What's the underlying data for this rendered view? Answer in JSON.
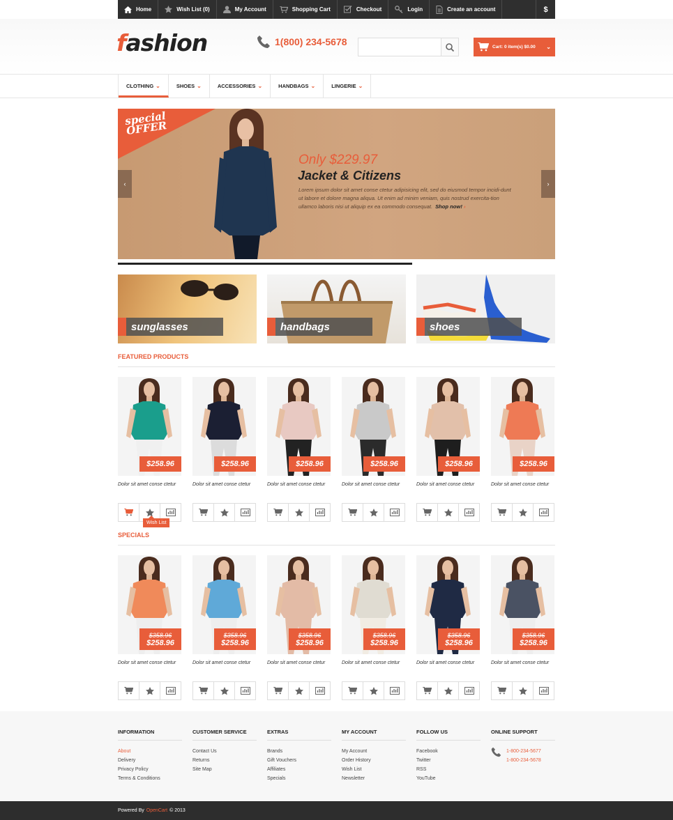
{
  "topbar": {
    "items": [
      {
        "label": "Home",
        "icon": "home-icon"
      },
      {
        "label": "Wish List (0)",
        "icon": "star-icon"
      },
      {
        "label": "My Account",
        "icon": "user-icon"
      },
      {
        "label": "Shopping Cart",
        "icon": "cart-icon"
      },
      {
        "label": "Checkout",
        "icon": "checkout-icon"
      },
      {
        "label": "Login",
        "icon": "key-icon"
      },
      {
        "label": "Create an account",
        "icon": "document-icon"
      }
    ],
    "currency": "$"
  },
  "header": {
    "logo_first": "f",
    "logo_rest": "ashion",
    "phone": "1(800) 234-5678",
    "search_placeholder": "",
    "cart_label": "Cart: 0 item(s) $0.00"
  },
  "nav": [
    {
      "label": "CLOTHING"
    },
    {
      "label": "SHOES"
    },
    {
      "label": "ACCESSORIES"
    },
    {
      "label": "HANDBAGS"
    },
    {
      "label": "LINGERIE"
    }
  ],
  "slider": {
    "badge_line1": "special",
    "badge_line2": "OFFER",
    "price": "Only $229.97",
    "title": "Jacket & Citizens",
    "text": "Lorem ipsum dolor sit amet conse ctetur adipisicing elit, sed do eiusmod tempor incidi-dunt ut labore et dolore magna aliqua. Ut enim ad minim veniam, quis nostrud exercita-tion ullamco laboris nisi ut aliquip ex ea commodo consequat.",
    "shop_now": "Shop now!"
  },
  "banners": [
    {
      "label": "sunglasses"
    },
    {
      "label": "handbags"
    },
    {
      "label": "shoes"
    }
  ],
  "featured": {
    "title": "FEATURED PRODUCTS",
    "products": [
      {
        "price": "$258.96",
        "name": "Dolor sit amet conse ctetur",
        "top": "#1a9e8c",
        "bottom": "#f0f0f0"
      },
      {
        "price": "$258.96",
        "name": "Dolor sit amet conse ctetur",
        "top": "#1b1f33",
        "bottom": "#dcdcdc"
      },
      {
        "price": "$258.96",
        "name": "Dolor sit amet conse ctetur",
        "top": "#e8c9c2",
        "bottom": "#222222"
      },
      {
        "price": "$258.96",
        "name": "Dolor sit amet conse ctetur",
        "top": "#c9c9c9",
        "bottom": "#2b2b2b"
      },
      {
        "price": "$258.96",
        "name": "Dolor sit amet conse ctetur",
        "top": "#e2c0aa",
        "bottom": "#1e1e1e"
      },
      {
        "price": "$258.96",
        "name": "Dolor sit amet conse ctetur",
        "top": "#ee7a55",
        "bottom": "#e9d3c7"
      }
    ]
  },
  "wishlist_tooltip": "Wish List",
  "specials": {
    "title": "SPECIALS",
    "products": [
      {
        "old": "$358.96",
        "price": "$258.96",
        "name": "Dolor sit amet conse ctetur",
        "top": "#f08a5a",
        "bottom": "#eeeeee"
      },
      {
        "old": "$358.96",
        "price": "$258.96",
        "name": "Dolor sit amet conse ctetur",
        "top": "#5fa9d8",
        "bottom": "#eeeeee"
      },
      {
        "old": "$358.96",
        "price": "$258.96",
        "name": "Dolor sit amet conse ctetur",
        "top": "#e3bba6",
        "bottom": "#e3bba6"
      },
      {
        "old": "$358.96",
        "price": "$258.96",
        "name": "Dolor sit amet conse ctetur",
        "top": "#e0dcd2",
        "bottom": "#f1ece3"
      },
      {
        "old": "$358.96",
        "price": "$258.96",
        "name": "Dolor sit amet conse ctetur",
        "top": "#1f2a44",
        "bottom": "#1f2a44"
      },
      {
        "old": "$358.96",
        "price": "$258.96",
        "name": "Dolor sit amet conse ctetur",
        "top": "#4a5263",
        "bottom": "#eeeeee"
      }
    ]
  },
  "footer": {
    "columns": [
      {
        "title": "INFORMATION",
        "links": [
          "About",
          "Delivery",
          "Privacy Policy",
          "Terms & Conditions"
        ]
      },
      {
        "title": "CUSTOMER SERVICE",
        "links": [
          "Contact Us",
          "Returns",
          "Site Map"
        ]
      },
      {
        "title": "EXTRAS",
        "links": [
          "Brands",
          "Gift Vouchers",
          "Affiliates",
          "Specials"
        ]
      },
      {
        "title": "MY ACCOUNT",
        "links": [
          "My Account",
          "Order History",
          "Wish List",
          "Newsletter"
        ]
      },
      {
        "title": "FOLLOW US",
        "links": [
          "Facebook",
          "Twitter",
          "RSS",
          "YouTube"
        ]
      }
    ],
    "support": {
      "title": "ONLINE SUPPORT",
      "phones": [
        "1-800-234-5677",
        "1-800-234-5678"
      ]
    },
    "powered_by": "Powered By",
    "opencart": "OpenCart",
    "year": "© 2013"
  },
  "colors": {
    "accent": "#e85d3a",
    "dark": "#2f2f2f"
  }
}
